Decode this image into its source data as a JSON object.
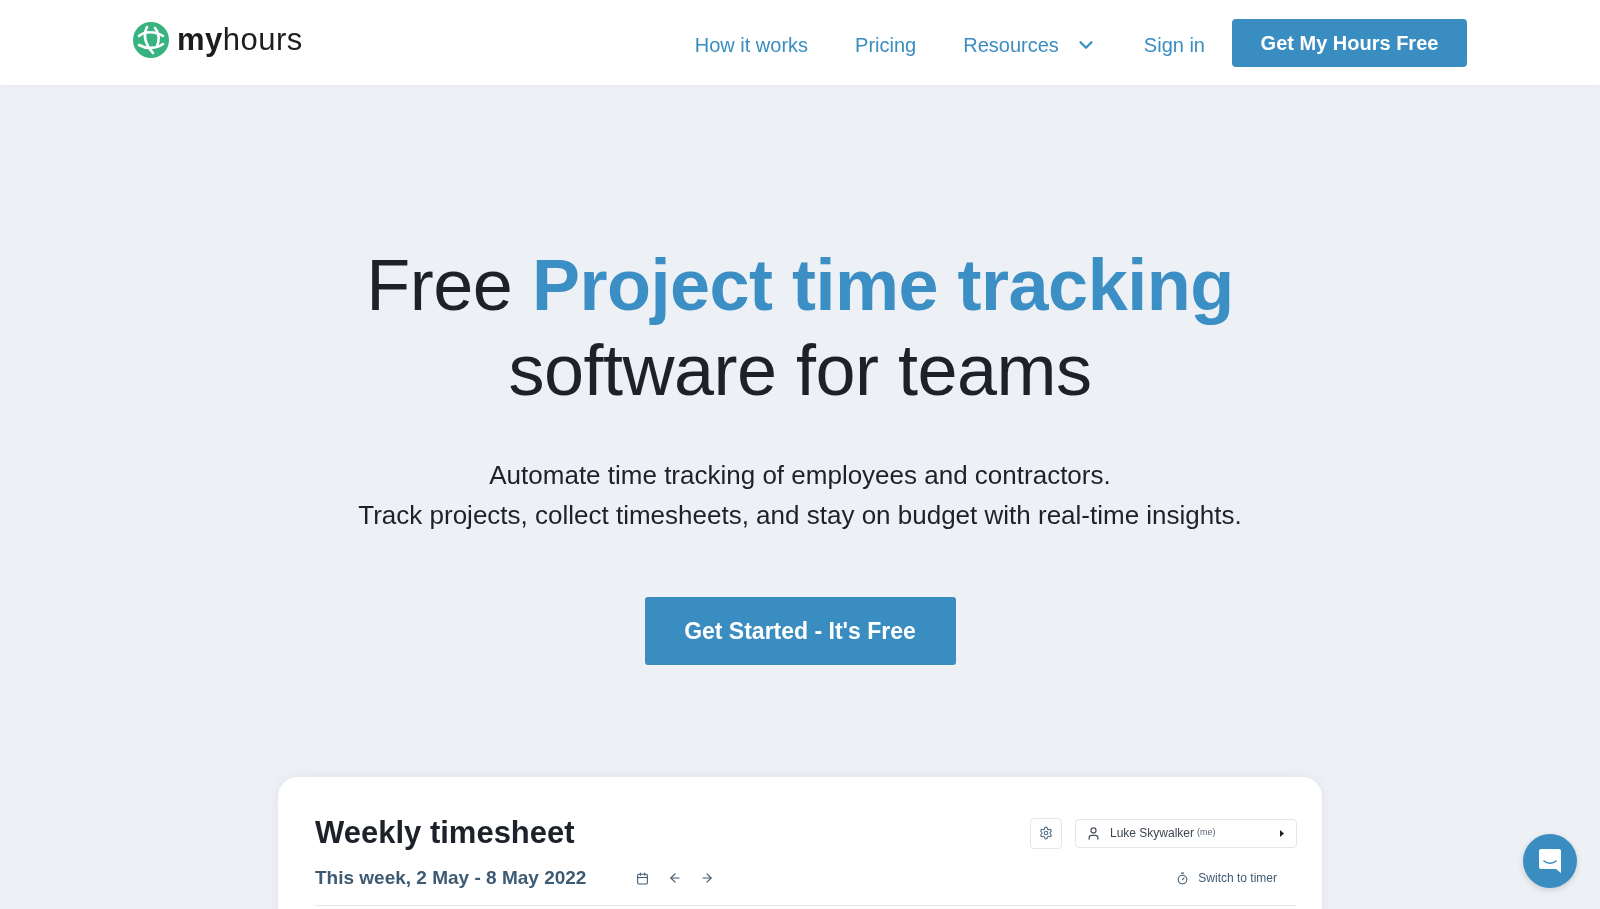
{
  "header": {
    "logo_text": "**my**hours",
    "nav": [
      {
        "label": "How it works",
        "kind": "link"
      },
      {
        "label": "Pricing",
        "kind": "link"
      },
      {
        "label": "Resources",
        "kind": "dropdown"
      },
      {
        "label": "Sign in",
        "kind": "link"
      }
    ],
    "cta": "Get My Hours Free"
  },
  "hero": {
    "title_lead": "Free",
    "title_highlight": "Project time tracking",
    "title_tail": "software for teams",
    "subtitle_lines": [
      "Automate time tracking of employees and contractors.",
      "Track projects, collect timesheets, and stay on budget with real-time insights."
    ],
    "button": "Get Started - It's Free"
  },
  "timesheet": {
    "title": "Weekly timesheet",
    "week": "This week, 2 May - 8 May 2022",
    "user": "Luke Skywalker",
    "user_note": "(me)",
    "switch": "Switch to timer"
  }
}
